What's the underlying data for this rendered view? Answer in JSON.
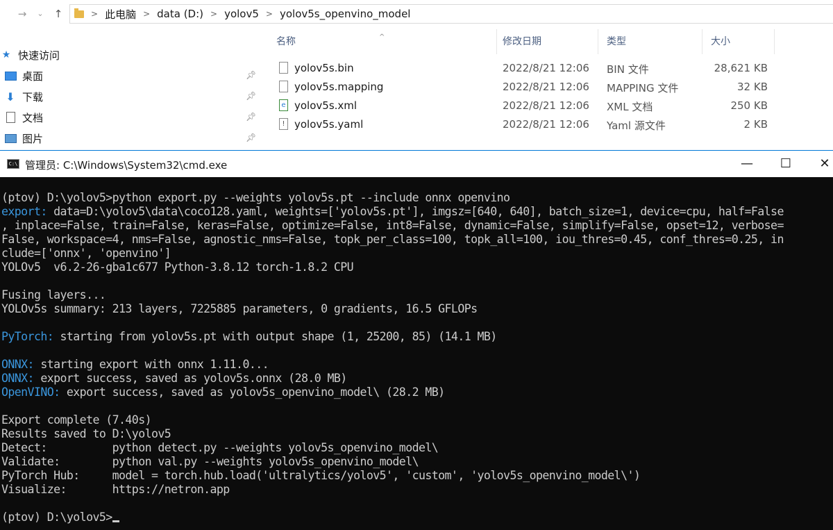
{
  "explorer": {
    "breadcrumb": [
      "此电脑",
      "data (D:)",
      "yolov5",
      "yolov5s_openvino_model"
    ],
    "nav_items": [
      {
        "label": "快速访问",
        "icon": "star-icon"
      },
      {
        "label": "桌面",
        "icon": "desktop-icon"
      },
      {
        "label": "下载",
        "icon": "download-icon"
      },
      {
        "label": "文档",
        "icon": "document-icon"
      },
      {
        "label": "图片",
        "icon": "picture-icon"
      }
    ],
    "columns": {
      "name": "名称",
      "date": "修改日期",
      "type": "类型",
      "size": "大小"
    },
    "files": [
      {
        "name": "yolov5s.bin",
        "date": "2022/8/21 12:06",
        "type": "BIN 文件",
        "size": "28,621 KB",
        "icon": "file-icon"
      },
      {
        "name": "yolov5s.mapping",
        "date": "2022/8/21 12:06",
        "type": "MAPPING 文件",
        "size": "32 KB",
        "icon": "file-icon"
      },
      {
        "name": "yolov5s.xml",
        "date": "2022/8/21 12:06",
        "type": "XML 文档",
        "size": "250 KB",
        "icon": "xml-file-icon"
      },
      {
        "name": "yolov5s.yaml",
        "date": "2022/8/21 12:06",
        "type": "Yaml 源文件",
        "size": "2 KB",
        "icon": "yaml-file-icon"
      }
    ]
  },
  "cmd": {
    "title": "管理员: C:\\Windows\\System32\\cmd.exe",
    "lines": [
      {
        "parts": [
          {
            "t": "(ptov) D:\\yolov5>python export.py --weights yolov5s.pt --include onnx openvino"
          }
        ]
      },
      {
        "parts": [
          {
            "t": "export: ",
            "c": "blue"
          },
          {
            "t": "data=D:\\yolov5\\data\\coco128.yaml, weights=['yolov5s.pt'], imgsz=[640, 640], batch_size=1, device=cpu, half=False"
          }
        ]
      },
      {
        "parts": [
          {
            "t": ", inplace=False, train=False, keras=False, optimize=False, int8=False, dynamic=False, simplify=False, opset=12, verbose="
          }
        ]
      },
      {
        "parts": [
          {
            "t": "False, workspace=4, nms=False, agnostic_nms=False, topk_per_class=100, topk_all=100, iou_thres=0.45, conf_thres=0.25, in"
          }
        ]
      },
      {
        "parts": [
          {
            "t": "clude=['onnx', 'openvino']"
          }
        ]
      },
      {
        "parts": [
          {
            "t": "YOLOv5  v6.2-26-gba1c677 Python-3.8.12 torch-1.8.2 CPU"
          }
        ]
      },
      {
        "parts": [
          {
            "t": ""
          }
        ]
      },
      {
        "parts": [
          {
            "t": "Fusing layers..."
          }
        ]
      },
      {
        "parts": [
          {
            "t": "YOLOv5s summary: 213 layers, 7225885 parameters, 0 gradients, 16.5 GFLOPs"
          }
        ]
      },
      {
        "parts": [
          {
            "t": ""
          }
        ]
      },
      {
        "parts": [
          {
            "t": "PyTorch: ",
            "c": "blue"
          },
          {
            "t": "starting from yolov5s.pt with output shape (1, 25200, 85) (14.1 MB)"
          }
        ]
      },
      {
        "parts": [
          {
            "t": ""
          }
        ]
      },
      {
        "parts": [
          {
            "t": "ONNX: ",
            "c": "blue"
          },
          {
            "t": "starting export with onnx 1.11.0..."
          }
        ]
      },
      {
        "parts": [
          {
            "t": "ONNX: ",
            "c": "blue"
          },
          {
            "t": "export success, saved as yolov5s.onnx (28.0 MB)"
          }
        ]
      },
      {
        "parts": [
          {
            "t": "OpenVINO: ",
            "c": "blue"
          },
          {
            "t": "export success, saved as yolov5s_openvino_model\\ (28.2 MB)"
          }
        ]
      },
      {
        "parts": [
          {
            "t": ""
          }
        ]
      },
      {
        "parts": [
          {
            "t": "Export complete (7.40s)"
          }
        ]
      },
      {
        "parts": [
          {
            "t": "Results saved to D:\\yolov5"
          }
        ]
      },
      {
        "parts": [
          {
            "t": "Detect:          python detect.py --weights yolov5s_openvino_model\\"
          }
        ]
      },
      {
        "parts": [
          {
            "t": "Validate:        python val.py --weights yolov5s_openvino_model\\"
          }
        ]
      },
      {
        "parts": [
          {
            "t": "PyTorch Hub:     model = torch.hub.load('ultralytics/yolov5', 'custom', 'yolov5s_openvino_model\\')"
          }
        ]
      },
      {
        "parts": [
          {
            "t": "Visualize:       https://netron.app"
          }
        ]
      },
      {
        "parts": [
          {
            "t": ""
          }
        ]
      },
      {
        "parts": [
          {
            "t": "(ptov) D:\\yolov5>"
          }
        ],
        "cursor": true
      }
    ]
  },
  "colors": {
    "console_bg": "#0c0c0c",
    "console_text": "#cccccc",
    "console_blue": "#3a96dd",
    "accent": "#0078d7"
  }
}
